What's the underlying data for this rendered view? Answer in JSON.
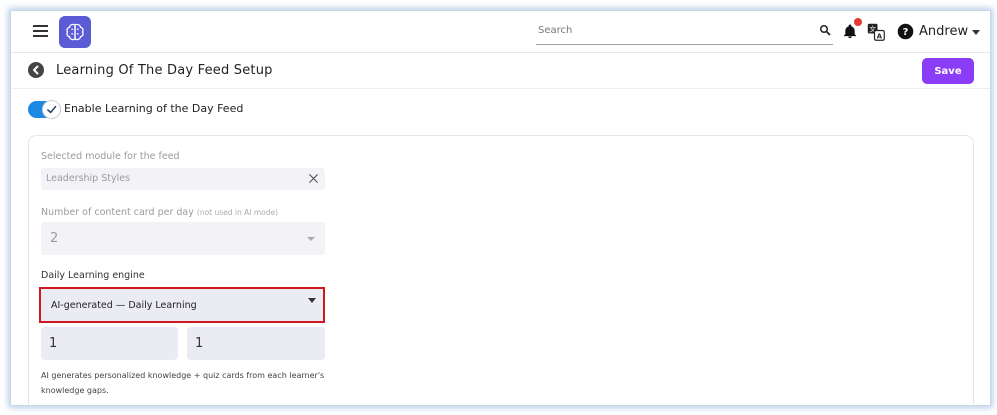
{
  "header": {
    "search_placeholder": "Search",
    "user_name": "Andrew",
    "icons": [
      "menu-icon",
      "brain-logo-icon",
      "search-icon",
      "bell-icon",
      "translate-icon",
      "help-icon",
      "chevron-down-icon"
    ],
    "notification_color": "#e53935"
  },
  "page": {
    "title": "Learning Of The Day Feed Setup",
    "save_label": "Save",
    "accent_color": "#8b3cf7"
  },
  "toggle": {
    "label": "Enable Learning of the Day Feed",
    "enabled": true
  },
  "form": {
    "module_label": "Selected module for the feed",
    "module_value": "Leadership Styles",
    "count_label": "Number of content card per day",
    "count_hint": "(not used in AI mode)",
    "count_value": "2",
    "engine_label": "Daily Learning engine",
    "engine_value": "AI-generated — Daily Learning",
    "input_a_value": "1",
    "input_b_value": "1",
    "help_text": "AI generates personalized knowledge + quiz cards from each learner's knowledge gaps."
  }
}
